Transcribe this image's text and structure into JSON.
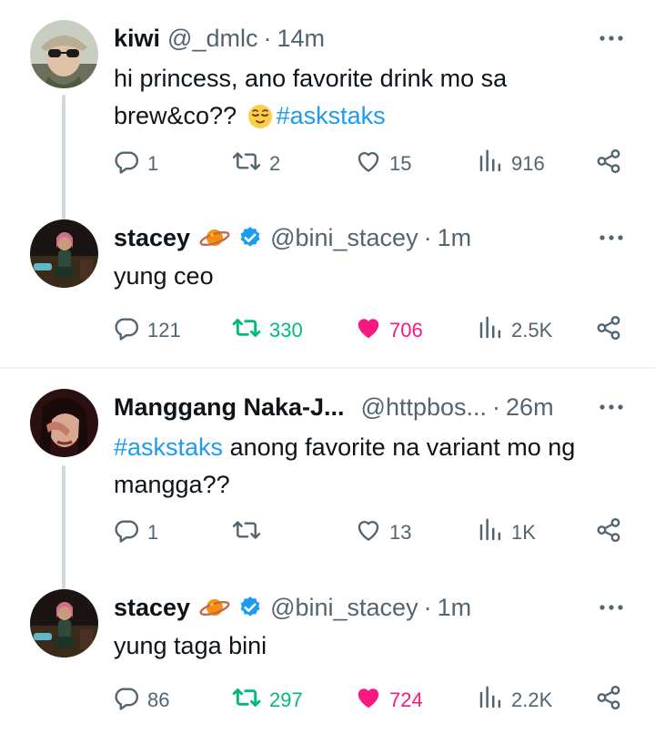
{
  "threads": [
    {
      "question": {
        "name": "kiwi",
        "handle": "@_dmlc",
        "separator": "·",
        "time": "14m",
        "text_plain": "hi princess, ano favorite drink mo sa brew&co?? ",
        "emoji_name": "relieved-face-emoji",
        "hashtag": "#askstaks",
        "replies": "1",
        "reposts": "2",
        "likes": "15",
        "views": "916"
      },
      "answer": {
        "name": "stacey",
        "handle": "@bini_stacey",
        "separator": "·",
        "time": "1m",
        "text": "yung ceo",
        "replies": "121",
        "reposts": "330",
        "likes": "706",
        "views": "2.5K",
        "reposted": true,
        "liked": true
      }
    },
    {
      "question": {
        "name": "Manggang Naka-J...",
        "handle": "@httpbos...",
        "separator": "·",
        "time": "26m",
        "hashtag": "#askstaks",
        "text_plain": " anong favorite na variant mo ng mangga??",
        "replies": "1",
        "reposts": "",
        "likes": "13",
        "views": "1K"
      },
      "answer": {
        "name": "stacey",
        "handle": "@bini_stacey",
        "separator": "·",
        "time": "1m",
        "text": "yung taga bini",
        "replies": "86",
        "reposts": "297",
        "likes": "724",
        "views": "2.2K",
        "reposted": true,
        "liked": true
      }
    }
  ],
  "colors": {
    "primary_text": "#0f1419",
    "secondary_text": "#536471",
    "hashtag": "#1d9bf0",
    "repost_active": "#00ba7c",
    "like_active": "#f91880",
    "verified_badge": "#1d9bf0",
    "thread_line": "#cfd9de"
  },
  "icons": [
    "more-icon",
    "reply-icon",
    "repost-icon",
    "like-icon",
    "views-icon",
    "share-icon",
    "verified-badge-icon",
    "planet-emoji-icon"
  ]
}
